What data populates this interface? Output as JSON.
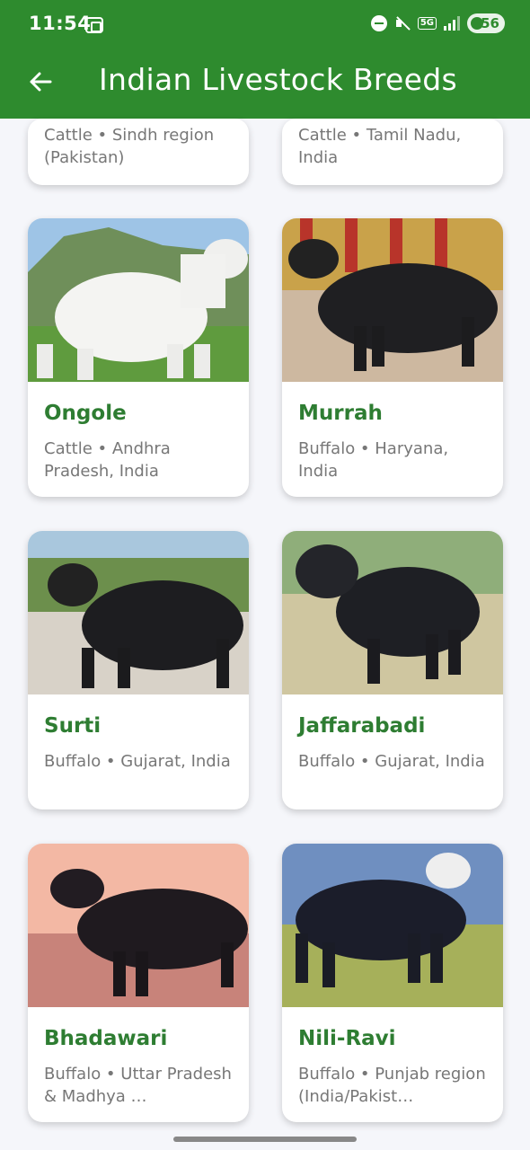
{
  "status_bar": {
    "time": "11:54",
    "network": "5G",
    "battery": "56"
  },
  "app_bar": {
    "title": "Indian Livestock Breeds",
    "back_icon": "arrow-left-icon"
  },
  "colors": {
    "primary": "#2e8b2e",
    "breed_name": "#2e7d32",
    "background": "#f5f6fa"
  },
  "breeds": [
    {
      "name": "",
      "description": "Cattle • Sindh region (Pakistan)"
    },
    {
      "name": "",
      "description": "Cattle • Tamil Nadu, India"
    },
    {
      "name": "Ongole",
      "description": "Cattle • Andhra Pradesh, India"
    },
    {
      "name": "Murrah",
      "description": "Buffalo • Haryana, India"
    },
    {
      "name": "Surti",
      "description": "Buffalo • Gujarat, India"
    },
    {
      "name": "Jaffarabadi",
      "description": "Buffalo • Gujarat, India"
    },
    {
      "name": "Bhadawari",
      "description": "Buffalo • Uttar Pradesh & Madhya …"
    },
    {
      "name": "Nili-Ravi",
      "description": "Buffalo • Punjab region (India/Pakist…"
    }
  ]
}
